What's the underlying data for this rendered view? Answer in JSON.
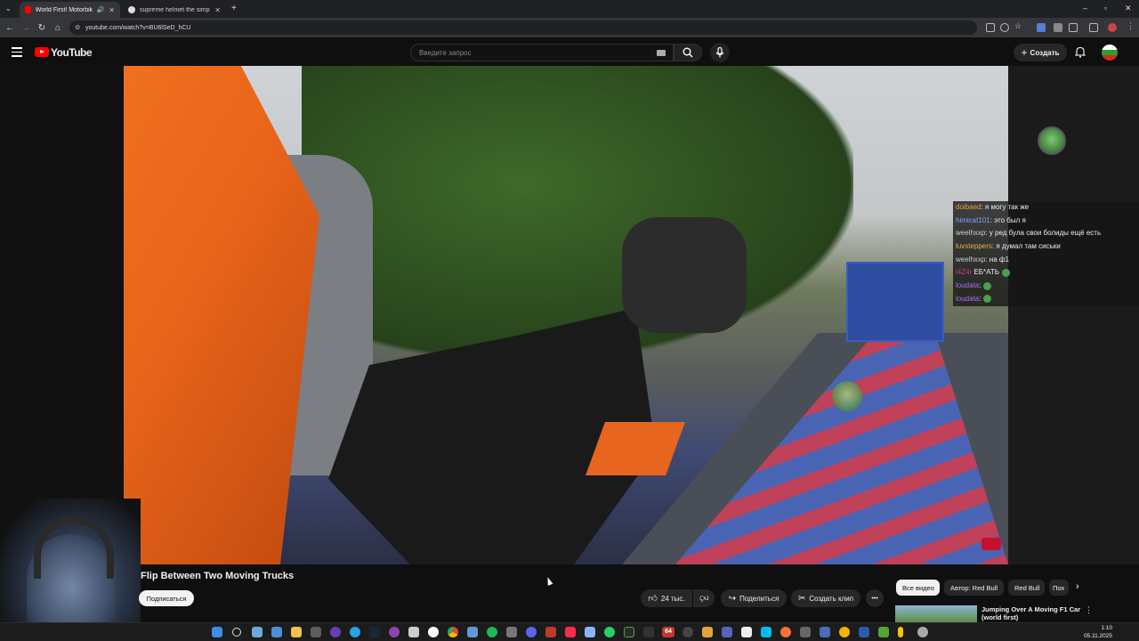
{
  "browser": {
    "tabs": [
      {
        "title": "World First! Motorbike Flip"
      },
      {
        "title": "supreme helmet the simpsons"
      }
    ],
    "new_tab": "+",
    "url": "youtube.com/watch?v=BU6lSeD_hCU"
  },
  "youtube": {
    "logo_text": "YouTube",
    "search_placeholder": "Введите запрос",
    "create_label": "Создать"
  },
  "chat": [
    {
      "user": "doibaed",
      "text": ": я могу так же",
      "color": "#e6a23c"
    },
    {
      "user": "himicat101",
      "text": ": это был я",
      "color": "#7aa7ff"
    },
    {
      "user": "weelhxxp",
      "text": ": у ред була свои болиды ещё есть",
      "color": "#cccccc"
    },
    {
      "user": "luvsteppers",
      "text": ": я думал там сиськи",
      "color": "#e6b83c"
    },
    {
      "user": "weelhxxp",
      "text": ": на ф1",
      "color": "#cccccc"
    },
    {
      "user": "i4Z4r",
      "text": " ЕБ*АТЬ",
      "color": "#d0368a"
    },
    {
      "user": "loudata",
      "text": ":",
      "color": "#a970ff"
    },
    {
      "user": "loudata",
      "text": ":",
      "color": "#a970ff"
    }
  ],
  "video": {
    "title": "Flip Between Two Moving Trucks",
    "subscribe_label": "Подписаться",
    "likes": "24 тыс.",
    "share_label": "Поделиться",
    "clip_label": "Создать клип",
    "more_label": "•••"
  },
  "sidebar": {
    "chips": [
      "Все видео",
      "Автор: Red Bull",
      "Red Bull",
      "Пох"
    ],
    "recommendation_title": "Jumping Over A Moving F1 Car (world first)",
    "menu": "⋮"
  },
  "taskbar": {
    "time": "1:10",
    "date": "05.11.2025",
    "badge": "64"
  },
  "colors": {
    "youtube_red": "#ff0000",
    "background": "#0f0f0f",
    "pill": "#272727"
  }
}
